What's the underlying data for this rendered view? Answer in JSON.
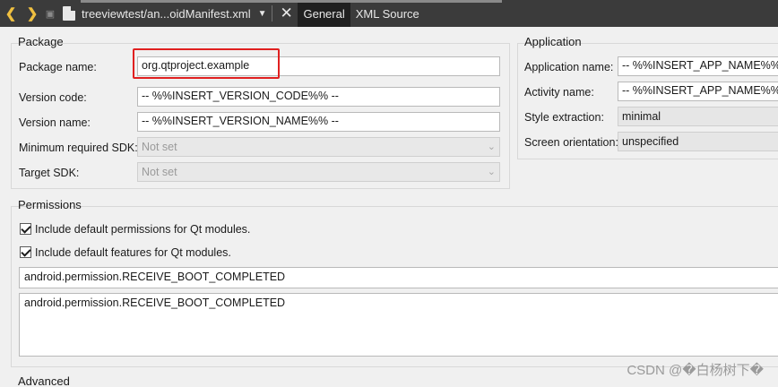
{
  "toolbar": {
    "back": "❮",
    "forward": "❯",
    "file_name": "treeviewtest/an...oidManifest.xml",
    "tabs": [
      {
        "label": "General"
      },
      {
        "label": "XML Source"
      }
    ]
  },
  "package": {
    "title": "Package",
    "rows": [
      {
        "label": "Package name:",
        "value": "org.qtproject.example"
      },
      {
        "label": "Version code:",
        "value": "-- %%INSERT_VERSION_CODE%% --"
      },
      {
        "label": "Version name:",
        "value": "-- %%INSERT_VERSION_NAME%% --"
      },
      {
        "label": "Minimum required SDK:",
        "value": "Not set"
      },
      {
        "label": "Target SDK:",
        "value": "Not set"
      }
    ]
  },
  "application": {
    "title": "Application",
    "rows": [
      {
        "label": "Application name:",
        "value": "-- %%INSERT_APP_NAME%% --"
      },
      {
        "label": "Activity name:",
        "value": "-- %%INSERT_APP_NAME%% --"
      },
      {
        "label": "Style extraction:",
        "value": "minimal"
      },
      {
        "label": "Screen orientation:",
        "value": "unspecified"
      }
    ]
  },
  "permissions": {
    "title": "Permissions",
    "checks": [
      {
        "label": "Include default permissions for Qt modules."
      },
      {
        "label": "Include default features for Qt modules."
      }
    ],
    "input_value": "android.permission.RECEIVE_BOOT_COMPLETED",
    "list": [
      "android.permission.RECEIVE_BOOT_COMPLETED"
    ]
  },
  "advanced": {
    "title": "Advanced"
  },
  "watermark": "CSDN @�白杨树下�"
}
